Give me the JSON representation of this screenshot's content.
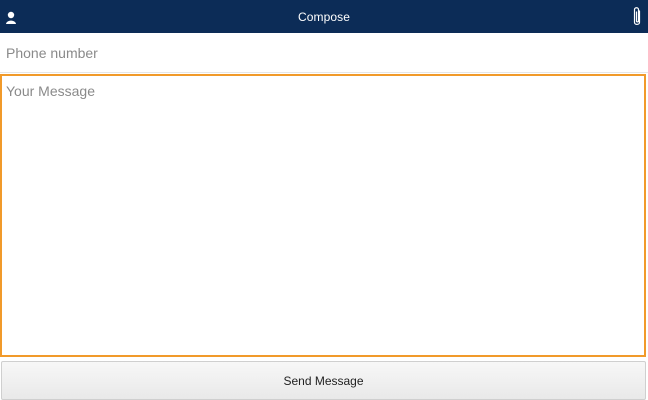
{
  "header": {
    "title": "Compose",
    "left_icon": "contact-icon",
    "right_icon": "paperclip-icon"
  },
  "phone": {
    "placeholder": "Phone number",
    "value": ""
  },
  "message": {
    "placeholder": "Your Message",
    "value": ""
  },
  "actions": {
    "send_label": "Send Message"
  },
  "colors": {
    "header_bg": "#0c2c57",
    "focus_border": "#f19a2a"
  }
}
